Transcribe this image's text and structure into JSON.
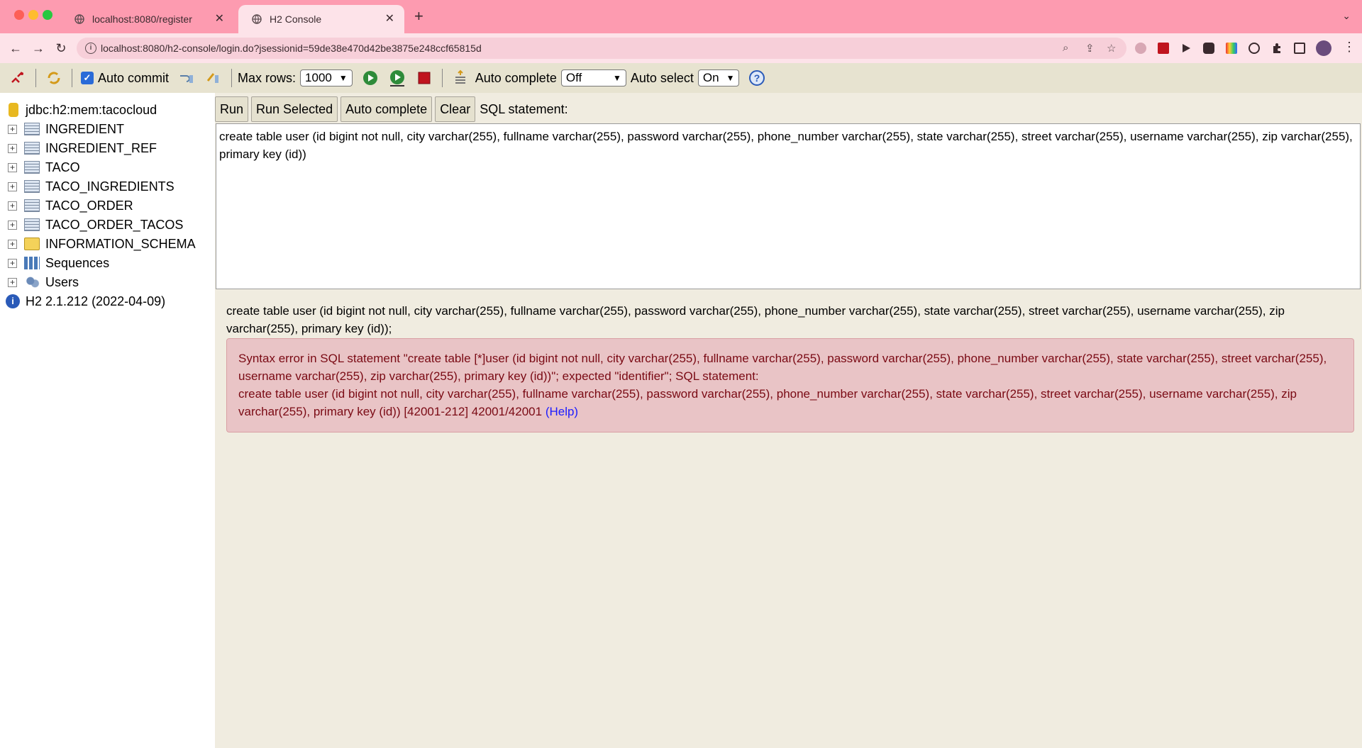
{
  "browser": {
    "tabs": [
      {
        "title": "localhost:8080/register"
      },
      {
        "title": "H2 Console"
      }
    ],
    "url": "localhost:8080/h2-console/login.do?jsessionid=59de38e470d42be3875e248ccf65815d"
  },
  "toolbar": {
    "auto_commit_label": "Auto commit",
    "max_rows_label": "Max rows:",
    "max_rows_value": "1000",
    "auto_complete_label": "Auto complete",
    "auto_complete_value": "Off",
    "auto_select_label": "Auto select",
    "auto_select_value": "On",
    "help_glyph": "?"
  },
  "tree": {
    "db": "jdbc:h2:mem:tacocloud",
    "tables": [
      "INGREDIENT",
      "INGREDIENT_REF",
      "TACO",
      "TACO_INGREDIENTS",
      "TACO_ORDER",
      "TACO_ORDER_TACOS"
    ],
    "schema": "INFORMATION_SCHEMA",
    "sequences": "Sequences",
    "users": "Users",
    "version": "H2 2.1.212 (2022-04-09)"
  },
  "editor": {
    "run": "Run",
    "run_selected": "Run Selected",
    "auto_complete": "Auto complete",
    "clear": "Clear",
    "sql_label": "SQL statement:",
    "sql": "create table user (id bigint not null, city varchar(255), fullname varchar(255), password varchar(255), phone_number varchar(255), state varchar(255), street varchar(255), username varchar(255), zip varchar(255), primary key (id))"
  },
  "result": {
    "statement": "create table user (id bigint not null, city varchar(255), fullname varchar(255), password varchar(255), phone_number varchar(255), state varchar(255), street varchar(255), username varchar(255), zip varchar(255), primary key (id));",
    "error_line1": "Syntax error in SQL statement \"create table [*]user (id bigint not null, city varchar(255), fullname varchar(255), password varchar(255), phone_number varchar(255), state varchar(255), street varchar(255), username varchar(255), zip varchar(255), primary key (id))\"; expected \"identifier\"; SQL statement:",
    "error_line2": "create table user (id bigint not null, city varchar(255), fullname varchar(255), password varchar(255), phone_number varchar(255), state varchar(255), street varchar(255), username varchar(255), zip varchar(255), primary key (id)) [42001-212] 42001/42001",
    "help": "(Help)"
  }
}
